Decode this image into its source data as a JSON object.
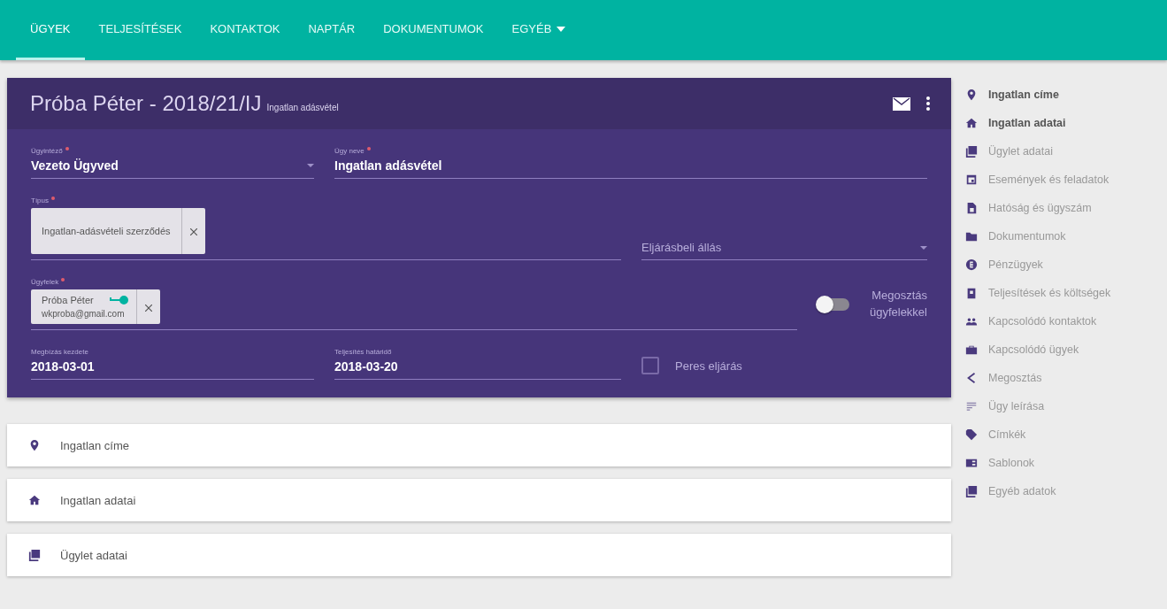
{
  "nav": {
    "tabs": [
      {
        "label": "ÜGYEK",
        "selected": true
      },
      {
        "label": "TELJESÍTÉSEK",
        "selected": false
      },
      {
        "label": "KONTAKTOK",
        "selected": false
      },
      {
        "label": "NAPTÁR",
        "selected": false
      },
      {
        "label": "DOKUMENTUMOK",
        "selected": false
      },
      {
        "label": "EGYÉB",
        "selected": false,
        "dropdown": true
      }
    ]
  },
  "case": {
    "title": "Próba Péter - 2018/21/IJ",
    "subtitle": "Ingatlan adásvétel",
    "responsible": {
      "label": "Ügyintéző",
      "required": true,
      "value": "Vezeto Ügyved"
    },
    "case_name": {
      "label": "Ügy neve",
      "required": true,
      "value": "Ingatlan adásvétel"
    },
    "type": {
      "label": "Típus",
      "required": true,
      "chips": [
        {
          "text": "Ingatlan-adásvételi szerződés"
        }
      ]
    },
    "procedure_status": {
      "placeholder": "Eljárásbeli állás"
    },
    "clients": {
      "label": "Ügyfelek",
      "required": true,
      "chips": [
        {
          "name": "Próba Péter",
          "email": "wkproba@gmail.com",
          "has_access": true
        }
      ]
    },
    "share_toggle": {
      "label": "Megosztás ügyfelekkel",
      "on": false
    },
    "start_date": {
      "label": "Megbízás kezdete",
      "value": "2018-03-01"
    },
    "deadline": {
      "label": "Teljesítés határidő",
      "value": "2018-03-20"
    },
    "litigation": {
      "label": "Peres eljárás",
      "checked": false
    }
  },
  "sections": [
    {
      "label": "Ingatlan címe"
    },
    {
      "label": "Ingatlan adatai"
    },
    {
      "label": "Ügylet adatai"
    }
  ],
  "sidebar": {
    "items": [
      {
        "label": "Ingatlan címe",
        "active": true
      },
      {
        "label": "Ingatlan adatai",
        "active": true
      },
      {
        "label": "Ügylet adatai",
        "active": false
      },
      {
        "label": "Események és feladatok",
        "active": false
      },
      {
        "label": "Hatóság és ügyszám",
        "active": false
      },
      {
        "label": "Dokumentumok",
        "active": false
      },
      {
        "label": "Pénzügyek",
        "active": false
      },
      {
        "label": "Teljesítések és költségek",
        "active": false
      },
      {
        "label": "Kapcsolódó kontaktok",
        "active": false
      },
      {
        "label": "Kapcsolódó ügyek",
        "active": false
      },
      {
        "label": "Megosztás",
        "active": false
      },
      {
        "label": "Ügy leírása",
        "active": false
      },
      {
        "label": "Címkék",
        "active": false
      },
      {
        "label": "Sablonok",
        "active": false
      },
      {
        "label": "Egyéb adatok",
        "active": false
      }
    ]
  }
}
